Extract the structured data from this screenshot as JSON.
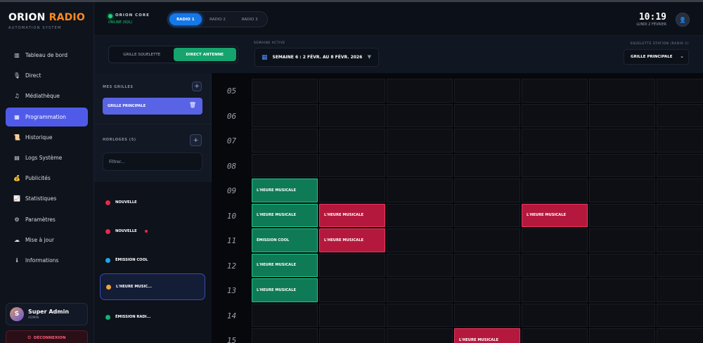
{
  "sidebar": {
    "brand_main": "ORION",
    "brand_accent": "RADIO",
    "brand_sub": "AUTOMATION SYSTEM",
    "items": [
      {
        "label": "Tableau de bord",
        "icon": "chart-icon"
      },
      {
        "label": "Direct",
        "icon": "microphone-icon"
      },
      {
        "label": "Médiathèque",
        "icon": "music-icon"
      },
      {
        "label": "Programmation",
        "icon": "calendar-icon",
        "active": true
      },
      {
        "label": "Historique",
        "icon": "scroll-icon"
      },
      {
        "label": "Logs Système",
        "icon": "terminal-icon"
      },
      {
        "label": "Publicités",
        "icon": "money-bag-icon"
      },
      {
        "label": "Statistiques",
        "icon": "stats-icon"
      },
      {
        "label": "Paramètres",
        "icon": "gear-icon"
      },
      {
        "label": "Mise à jour",
        "icon": "cloud-icon"
      },
      {
        "label": "Informations",
        "icon": "info-icon"
      }
    ],
    "user": {
      "initial": "S",
      "name": "Super Admin",
      "role": "ADMIN"
    },
    "logout_label": "DÉCONNEXION"
  },
  "header": {
    "core_title": "ORION CORE",
    "core_status": "ONLINE (SQL)",
    "radio_tabs": [
      "RADIO 1",
      "RADIO 2",
      "RADIO 3"
    ],
    "active_radio": 0,
    "clock": "10:19",
    "date": "LUNDI 2 FÉVRIER"
  },
  "toolbar": {
    "modes": [
      "GRILLE SQUELETTE",
      "DIRECT ANTENNE"
    ],
    "active_mode": 1,
    "week_label": "SEMAINE ACTIVE",
    "week_value": "SEMAINE 6 : 2 FÉVR. AU 8 FÉVR. 2026",
    "skeleton_label": "SQUELETTE STATION (RADIO 1)",
    "skeleton_value": "GRILLE PRINCIPALE"
  },
  "panel": {
    "grids_title": "MES GRILLES",
    "grid_items": [
      "GRILLE PRINCIPALE"
    ],
    "clocks_title": "HORLOGES (5)",
    "filter_placeholder": "Filtrer...",
    "clocks": [
      {
        "label": "NOUVELLE",
        "color": "#e8284a"
      },
      {
        "label": "NOUVELLE",
        "color": "#e8284a",
        "mini": "#e8284a"
      },
      {
        "label": "ÉMISSION COOL",
        "color": "#1ea7e8"
      },
      {
        "label": "L'HEURE MUSIC...",
        "color": "#f5a33a",
        "active": true
      },
      {
        "label": "ÉMISSION RADI...",
        "color": "#14b074"
      }
    ]
  },
  "schedule": {
    "hours": [
      "05",
      "06",
      "07",
      "08",
      "09",
      "10",
      "11",
      "12",
      "13",
      "14",
      "15"
    ],
    "days": 7,
    "events": [
      {
        "hour": 4,
        "day": 0,
        "label": "L'HEURE MUSICALE",
        "color": "green"
      },
      {
        "hour": 5,
        "day": 0,
        "label": "L'HEURE MUSICALE",
        "color": "green"
      },
      {
        "hour": 5,
        "day": 1,
        "label": "L'HEURE MUSICALE",
        "color": "red"
      },
      {
        "hour": 5,
        "day": 4,
        "label": "L'HEURE MUSICALE",
        "color": "red"
      },
      {
        "hour": 6,
        "day": 0,
        "label": "ÉMISSION COOL",
        "color": "green"
      },
      {
        "hour": 6,
        "day": 1,
        "label": "L'HEURE MUSICALE",
        "color": "red"
      },
      {
        "hour": 7,
        "day": 0,
        "label": "L'HEURE MUSICALE",
        "color": "green"
      },
      {
        "hour": 8,
        "day": 0,
        "label": "L'HEURE MUSICALE",
        "color": "green"
      },
      {
        "hour": 10,
        "day": 3,
        "label": "L'HEURE MUSICALE",
        "color": "red"
      }
    ]
  }
}
